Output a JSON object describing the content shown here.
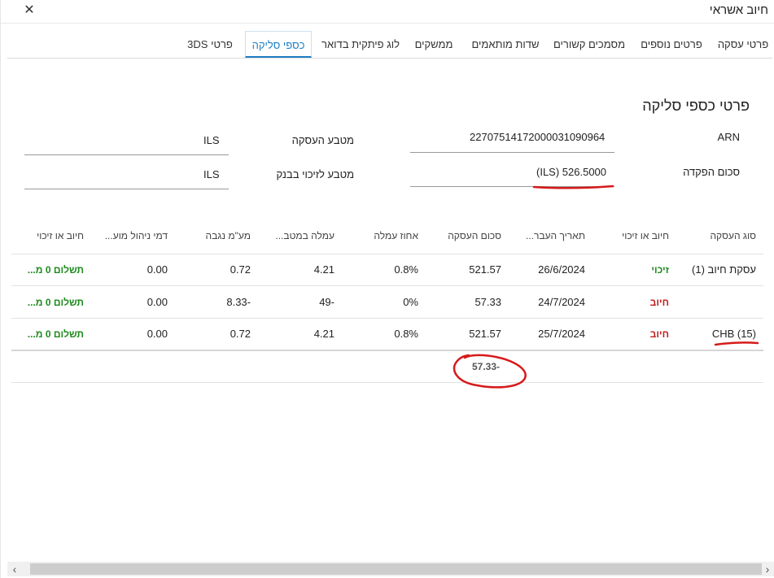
{
  "window": {
    "title": "חיוב אשראי",
    "close_glyph": "✕"
  },
  "tabs": [
    {
      "label": "פרטי עסקה"
    },
    {
      "label": "פרטים נוספים"
    },
    {
      "label": "מסמכים קשורים"
    },
    {
      "label": "שדות מותאמים"
    },
    {
      "label": "ממשקים"
    },
    {
      "label": "לוג פיתקית בדואר"
    },
    {
      "label": "כספי סליקה",
      "active": true
    },
    {
      "label": "פרטי 3DS"
    }
  ],
  "section": {
    "title": "פרטי כספי סליקה",
    "arn_label": "ARN",
    "arn_value": "22707514172000031090964",
    "deposit_label": "סכום הפקדה",
    "deposit_value": "(ILS) 526.5000",
    "currency_label": "מטבע העסקה",
    "currency_value": "ILS",
    "bank_currency_label": "מטבע לזיכוי בבנק",
    "bank_currency_value": "ILS"
  },
  "table": {
    "headers": [
      "סוג העסקה",
      "חיוב או זיכוי",
      "תאריך העבר...",
      "סכום העסקה",
      "אחוז עמלה",
      "עמלה במטב...",
      "מע\"מ נגבה",
      "דמי ניהול מוע...",
      "חיוב או זיכוי"
    ],
    "rows": [
      [
        "עסקת חיוב (1)",
        "זיכוי",
        "26/6/2024",
        "521.57",
        "0.8%",
        "4.21",
        "0.72",
        "0.00",
        "תשלום 0 מ..."
      ],
      [
        "",
        "חיוב",
        "24/7/2024",
        "57.33",
        "0%",
        "49-",
        "8.33-",
        "0.00",
        "תשלום 0 מ..."
      ],
      [
        "CHB (15)",
        "חיוב",
        "25/7/2024",
        "521.57",
        "0.8%",
        "4.21",
        "0.72",
        "0.00",
        "תשלום 0 מ..."
      ]
    ],
    "total": "57.33-"
  },
  "colors": {
    "accent": "#1f7fc4",
    "credit": "#1e8a1e",
    "debit": "#c21f1f",
    "annotation": "#d61a1a"
  },
  "scrollbar": {
    "left_arrow": "‹",
    "right_arrow": "›"
  }
}
